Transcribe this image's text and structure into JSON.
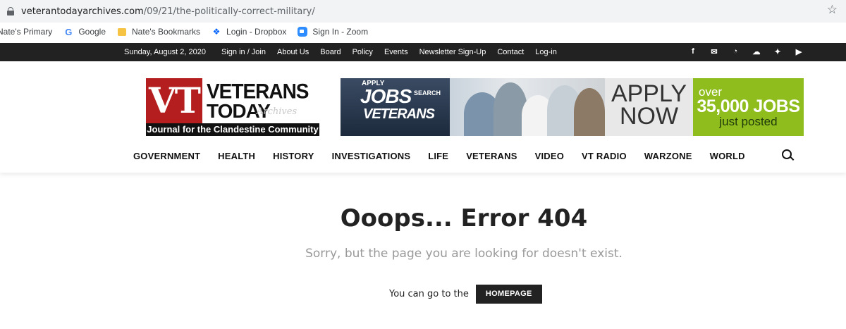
{
  "browser": {
    "url_host": "veterantodayarchives.com",
    "url_path": "/09/21/the-politically-correct-military/",
    "bookmarks": [
      {
        "label": "Nate's Primary"
      },
      {
        "label": "Google"
      },
      {
        "label": "Nate's Bookmarks"
      },
      {
        "label": "Login - Dropbox"
      },
      {
        "label": "Sign In - Zoom"
      }
    ]
  },
  "topbar": {
    "date": "Sunday, August 2, 2020",
    "links": [
      "Sign in / Join",
      "About Us",
      "Board",
      "Policy",
      "Events",
      "Newsletter Sign-Up",
      "Contact",
      "Log-in"
    ]
  },
  "logo": {
    "mark": "VT",
    "title_line1": "VETERANS",
    "title_line2": "TODAY",
    "archives": "Archives",
    "tagline": "Journal for the Clandestine Community"
  },
  "ad": {
    "apply_small": "APPLY",
    "jobs": "JOBS",
    "search": "SEARCH",
    "veterans": "VETERANS",
    "apply_now_line1": "APPLY",
    "apply_now_line2": "NOW",
    "over": "over",
    "count": "35,000 JOBS",
    "posted": "just posted"
  },
  "nav": {
    "items": [
      "GOVERNMENT",
      "HEALTH",
      "HISTORY",
      "INVESTIGATIONS",
      "LIFE",
      "VETERANS",
      "VIDEO",
      "VT RADIO",
      "WARZONE",
      "WORLD"
    ]
  },
  "error": {
    "title": "Ooops... Error 404",
    "subtitle": "Sorry, but the page you are looking for doesn't exist.",
    "home_prefix": "You can go to the",
    "home_button": "HOMEPAGE"
  },
  "colors": {
    "topbar_bg": "#222222",
    "logo_red": "#b41e1e",
    "ad_green": "#8fbd1d",
    "button_bg": "#222222"
  }
}
